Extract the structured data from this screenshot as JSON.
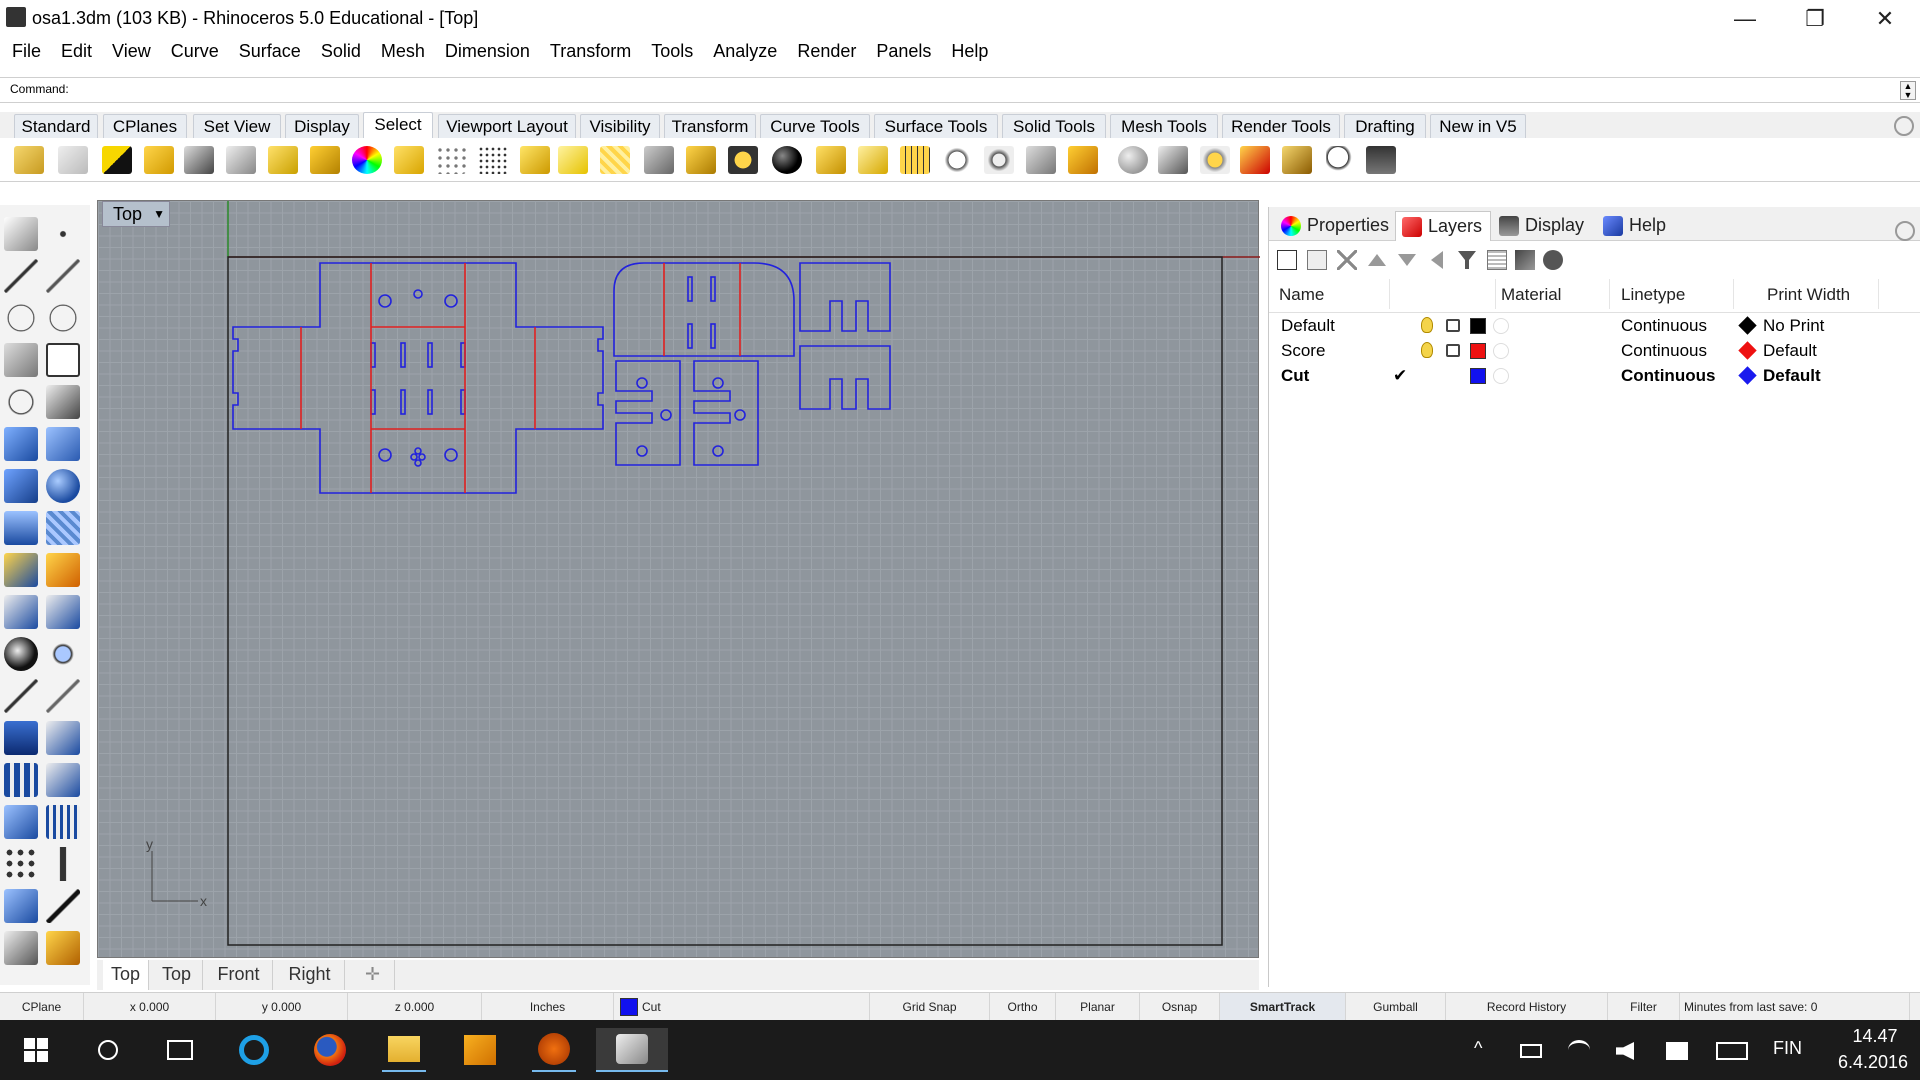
{
  "window": {
    "title": "osa1.3dm (103 KB) - Rhinoceros 5.0 Educational - [Top]",
    "min_glyph": "—",
    "restore_glyph": "❐",
    "close_glyph": "✕"
  },
  "menu": [
    "File",
    "Edit",
    "View",
    "Curve",
    "Surface",
    "Solid",
    "Mesh",
    "Dimension",
    "Transform",
    "Tools",
    "Analyze",
    "Render",
    "Panels",
    "Help"
  ],
  "command": {
    "label": "Command:",
    "value": ""
  },
  "toolbar_tabs": [
    "Standard",
    "CPlanes",
    "Set View",
    "Display",
    "Select",
    "Viewport Layout",
    "Visibility",
    "Transform",
    "Curve Tools",
    "Surface Tools",
    "Solid Tools",
    "Mesh Tools",
    "Render Tools",
    "Drafting",
    "New in V5"
  ],
  "active_toolbar_tab": "Select",
  "viewport": {
    "title": "Top",
    "dropdown_glyph": "▼",
    "axis_y": "y",
    "axis_x": "x",
    "tabs": [
      "Top",
      "Top",
      "Front",
      "Right"
    ],
    "add_tab_glyph": "✛"
  },
  "panel": {
    "tabs": [
      "Properties",
      "Layers",
      "Display",
      "Help"
    ],
    "active_tab": "Layers",
    "columns": {
      "name": "Name",
      "material": "Material",
      "linetype": "Linetype",
      "print_width": "Print Width"
    },
    "layers": [
      {
        "name": "Default",
        "current": false,
        "color": "#000000",
        "linetype": "Continuous",
        "print_width": "No Print",
        "pw_color": "#000000"
      },
      {
        "name": "Score",
        "current": false,
        "color": "#ee1111",
        "linetype": "Continuous",
        "print_width": "Default",
        "pw_color": "#ee1111"
      },
      {
        "name": "Cut",
        "current": true,
        "current_mark": "✔",
        "color": "#1111ee",
        "linetype": "Continuous",
        "print_width": "Default",
        "pw_color": "#1a1aee"
      }
    ]
  },
  "statusbar": {
    "cplane": "CPlane",
    "x": "x 0.000",
    "y": "y 0.000",
    "z": "z 0.000",
    "units": "Inches",
    "layer": "Cut",
    "layer_color": "#1111ee",
    "grid_snap": "Grid Snap",
    "ortho": "Ortho",
    "planar": "Planar",
    "osnap": "Osnap",
    "smarttrack": "SmartTrack",
    "gumball": "Gumball",
    "record_history": "Record History",
    "filter": "Filter",
    "minutes": "Minutes from last save: 0"
  },
  "taskbar": {
    "language": "FIN",
    "time": "14.47",
    "date": "6.4.2016"
  },
  "colors": {
    "cut": "#2222dd",
    "score": "#e02020",
    "border": "#8a1a1a"
  }
}
